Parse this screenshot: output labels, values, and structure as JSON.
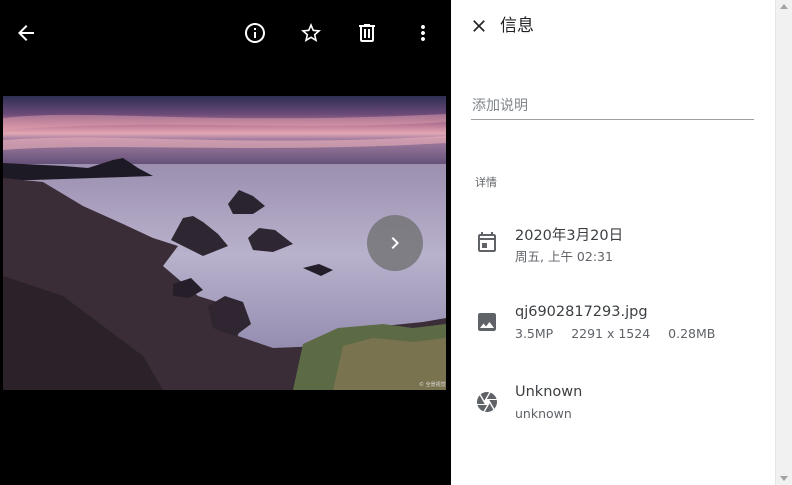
{
  "viewer": {
    "icons": {
      "back": "arrow-left-icon",
      "info": "info-circle-icon",
      "favorite": "star-outline-icon",
      "delete": "trash-icon",
      "more": "more-vertical-icon",
      "next": "chevron-right-icon"
    },
    "photo_credit": "© 全景视觉"
  },
  "panel": {
    "title": "信息",
    "caption_placeholder": "添加说明",
    "section_label": "详情",
    "date": {
      "icon": "calendar-icon",
      "primary": "2020年3月20日",
      "secondary": "周五, 上午 02:31"
    },
    "file": {
      "icon": "image-icon",
      "name": "qj6902817293.jpg",
      "megapixels": "3.5MP",
      "dimensions": "2291 x 1524",
      "size": "0.28MB"
    },
    "camera": {
      "icon": "aperture-icon",
      "primary": "Unknown",
      "secondary": "unknown"
    }
  },
  "colors": {
    "viewer_bg": "#000000",
    "panel_bg": "#ffffff",
    "icon_grey": "#5f6368",
    "text_primary": "#3c4043"
  }
}
